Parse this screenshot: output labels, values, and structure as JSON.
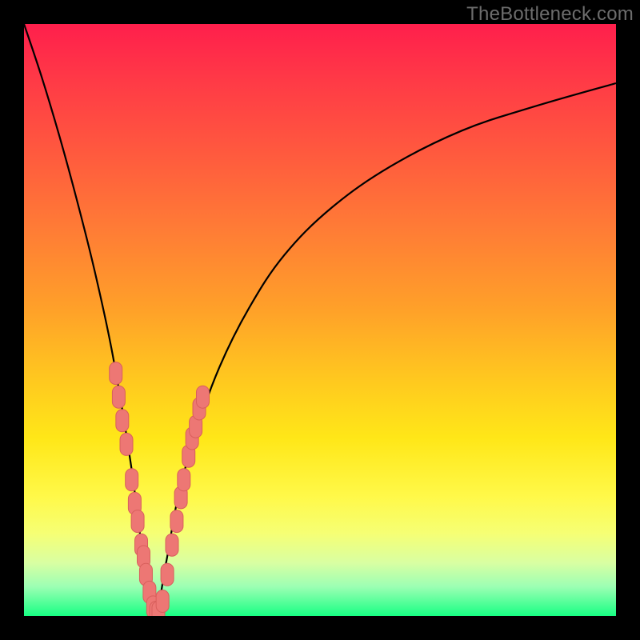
{
  "watermark": "TheBottleneck.com",
  "colors": {
    "frame": "#000000",
    "curve_stroke": "#000000",
    "marker_fill": "#ed7774",
    "marker_stroke": "#d85f5c"
  },
  "chart_data": {
    "type": "line",
    "title": "",
    "xlabel": "",
    "ylabel": "",
    "xlim": [
      0,
      100
    ],
    "ylim": [
      0,
      100
    ],
    "grid": false,
    "legend": false,
    "series": [
      {
        "name": "bottleneck-curve",
        "description": "V-shaped bottleneck curve; visual minimum near x≈22, y≈0",
        "x": [
          0,
          3,
          6,
          9,
          12,
          15,
          18,
          20,
          22,
          24,
          26,
          29,
          33,
          38,
          44,
          52,
          62,
          74,
          86,
          100
        ],
        "y": [
          100,
          91,
          81,
          70,
          58,
          44,
          26,
          11,
          0,
          9,
          20,
          31,
          42,
          52,
          61,
          69,
          76,
          82,
          86,
          90
        ]
      }
    ],
    "markers": {
      "description": "salmon data markers clustered along both arms near the minimum",
      "points": [
        {
          "x": 15.5,
          "y": 41
        },
        {
          "x": 16.0,
          "y": 37
        },
        {
          "x": 16.6,
          "y": 33
        },
        {
          "x": 17.3,
          "y": 29
        },
        {
          "x": 18.2,
          "y": 23
        },
        {
          "x": 18.7,
          "y": 19
        },
        {
          "x": 19.2,
          "y": 16
        },
        {
          "x": 19.8,
          "y": 12
        },
        {
          "x": 20.2,
          "y": 10
        },
        {
          "x": 20.6,
          "y": 7
        },
        {
          "x": 21.2,
          "y": 4
        },
        {
          "x": 21.8,
          "y": 1.5
        },
        {
          "x": 22.3,
          "y": 0.6
        },
        {
          "x": 22.7,
          "y": 0.6
        },
        {
          "x": 23.4,
          "y": 2.5
        },
        {
          "x": 24.2,
          "y": 7
        },
        {
          "x": 25.0,
          "y": 12
        },
        {
          "x": 25.8,
          "y": 16
        },
        {
          "x": 26.5,
          "y": 20
        },
        {
          "x": 27.0,
          "y": 23
        },
        {
          "x": 27.8,
          "y": 27
        },
        {
          "x": 28.4,
          "y": 30
        },
        {
          "x": 29.0,
          "y": 32
        },
        {
          "x": 29.6,
          "y": 35
        },
        {
          "x": 30.2,
          "y": 37
        }
      ]
    }
  }
}
